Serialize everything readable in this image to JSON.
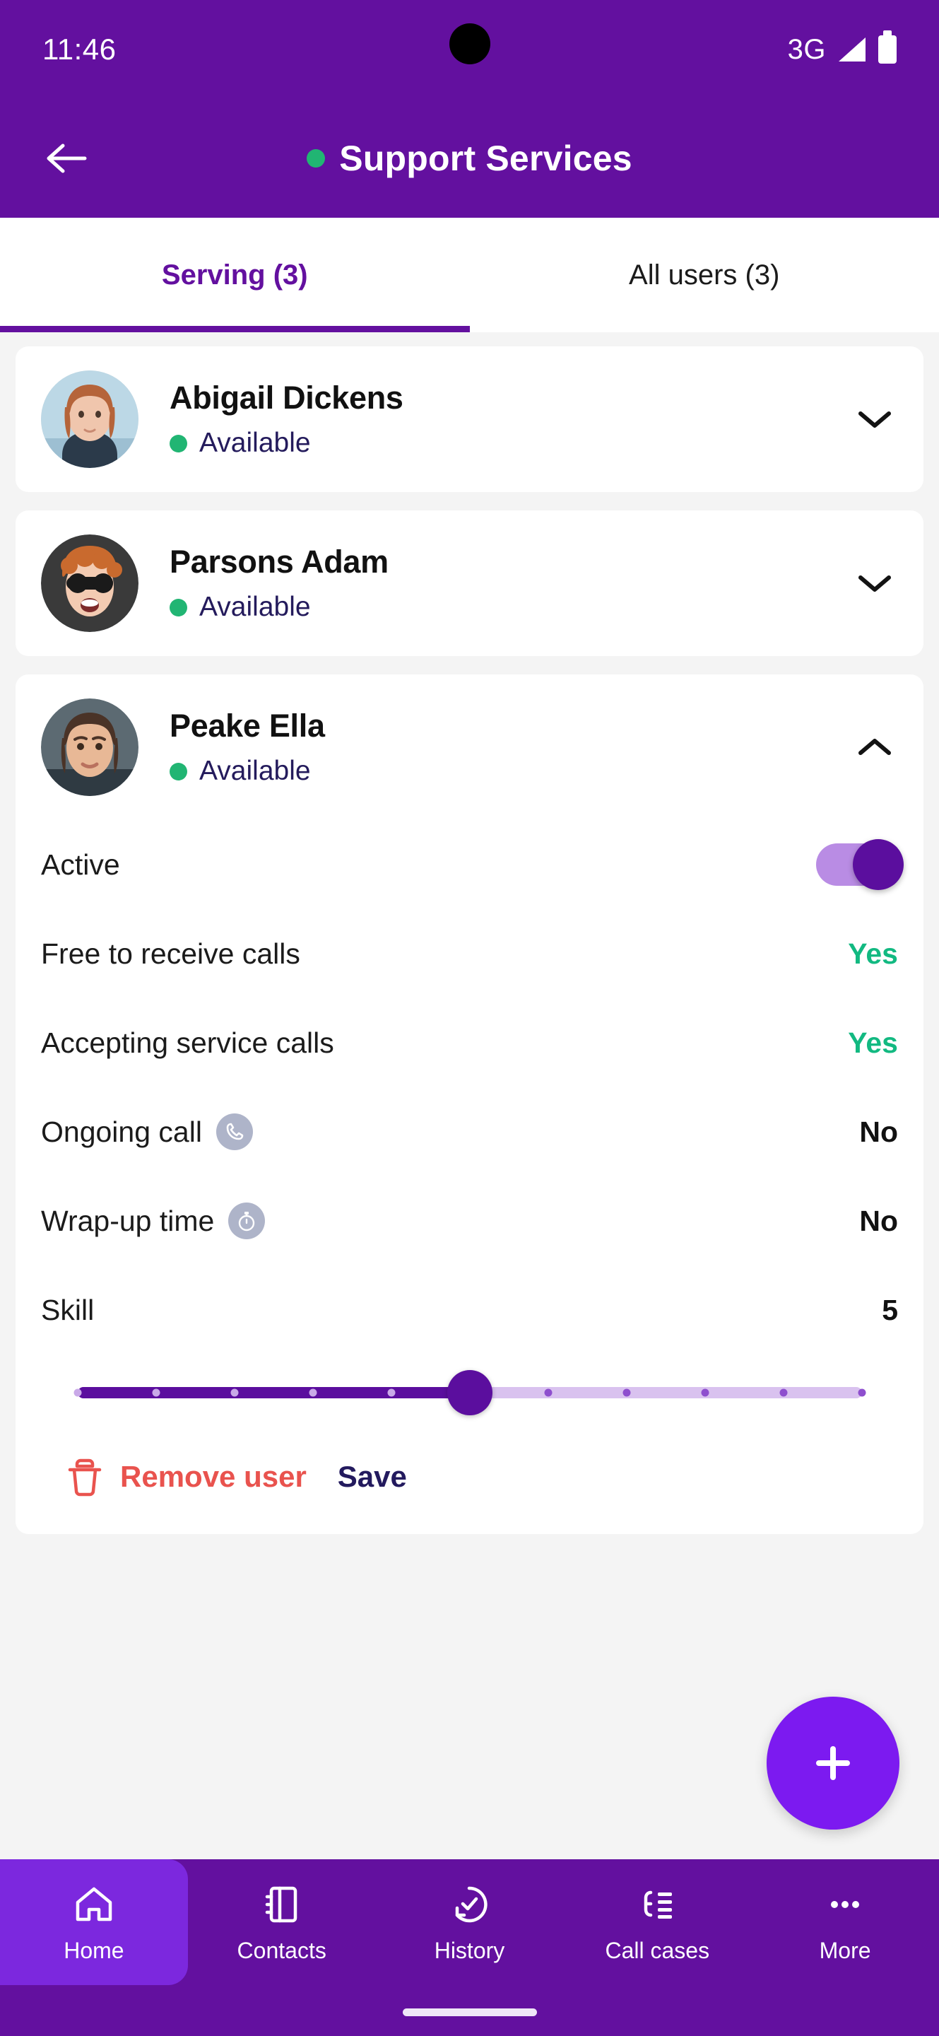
{
  "status_bar": {
    "time": "11:46",
    "network": "3G",
    "signal_icon": "signal-bars-icon",
    "battery_icon": "battery-full-icon"
  },
  "app_bar": {
    "back_icon": "arrow-left-icon",
    "presence_dot_color": "#21B573",
    "title": "Support Services"
  },
  "tabs": [
    {
      "label": "Serving (3)",
      "active": true
    },
    {
      "label": "All users (3)",
      "active": false
    }
  ],
  "users": [
    {
      "name": "Abigail Dickens",
      "status": "Available",
      "status_color": "#21B573",
      "expanded": false,
      "chevron_icon": "chevron-down-icon"
    },
    {
      "name": "Parsons Adam",
      "status": "Available",
      "status_color": "#21B573",
      "expanded": false,
      "chevron_icon": "chevron-down-icon"
    },
    {
      "name": "Peake Ella",
      "status": "Available",
      "status_color": "#21B573",
      "expanded": true,
      "chevron_icon": "chevron-up-icon"
    }
  ],
  "detail": {
    "rows": [
      {
        "label": "Active",
        "type": "toggle",
        "value": "on"
      },
      {
        "label": "Free to receive calls",
        "type": "text",
        "value": "Yes",
        "tone": "yes"
      },
      {
        "label": "Accepting service calls",
        "type": "text",
        "value": "Yes",
        "tone": "yes"
      },
      {
        "label": "Ongoing call",
        "type": "text",
        "value": "No",
        "tone": "no",
        "icon": "phone-icon"
      },
      {
        "label": "Wrap-up time",
        "type": "text",
        "value": "No",
        "tone": "no",
        "icon": "stopwatch-icon"
      },
      {
        "label": "Skill",
        "type": "number",
        "value": "5"
      }
    ],
    "skill_slider": {
      "value": 5,
      "min": 0,
      "max": 10,
      "ticks": 11,
      "fill_color": "#5B0E9E",
      "track_color": "#d9c2ef"
    },
    "actions": {
      "remove_label": "Remove user",
      "remove_icon": "trash-icon",
      "remove_color": "#e9534e",
      "save_label": "Save",
      "save_color": "#231a5e"
    }
  },
  "fab": {
    "icon": "plus-icon",
    "color": "#7C1AF0"
  },
  "bottom_nav": [
    {
      "label": "Home",
      "icon": "home-icon",
      "active": true
    },
    {
      "label": "Contacts",
      "icon": "contacts-book-icon",
      "active": false
    },
    {
      "label": "History",
      "icon": "history-check-icon",
      "active": false
    },
    {
      "label": "Call cases",
      "icon": "call-cases-list-icon",
      "active": false
    },
    {
      "label": "More",
      "icon": "more-dots-icon",
      "active": false
    }
  ],
  "theme": {
    "primary": "#63109F",
    "accent_green": "#21B573",
    "fab_purple": "#7C1AF0",
    "danger": "#e9534e"
  }
}
